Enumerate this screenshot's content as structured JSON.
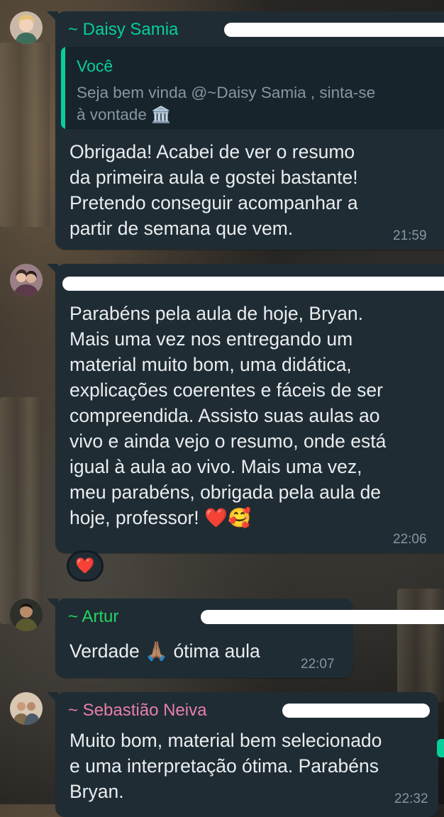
{
  "colors": {
    "bubble": "#1f2c33",
    "text": "#e9edef",
    "meta": "#8696a0",
    "quote_accent": "#06cf9c",
    "sender_daisy": "#06cf9c",
    "sender_artur": "#25d366",
    "sender_sebastiao": "#e87fa8"
  },
  "messages": [
    {
      "sender": "~ Daisy Samia",
      "avatar_icon": "woman-avatar-icon",
      "quote": {
        "author": "Você",
        "text": "Seja bem vinda @~Daisy Samia , sinta-se\nà vontade 🏛️"
      },
      "text": "Obrigada! Acabei de ver o resumo\nda primeira aula e gostei bastante!\nPretendo conseguir acompanhar a\npartir de semana que vem.",
      "time": "21:59"
    },
    {
      "sender": "",
      "avatar_icon": "couple-avatar-icon",
      "text": "Parabéns pela aula de hoje, Bryan.\nMais uma vez nos entregando um\nmaterial muito bom, uma didática,\nexplicações coerentes e fáceis de ser\ncompreendida. Assisto suas aulas ao\nvivo e ainda vejo o resumo, onde está\nigual à aula ao vivo. Mais uma vez,\nmeu parabéns, obrigada pela aula de\nhoje, professor! ❤️🥰",
      "time": "22:06",
      "reaction": "❤️"
    },
    {
      "sender": "~ Artur",
      "avatar_icon": "man-avatar-icon",
      "text": "Verdade 🙏🏽 ótima aula",
      "time": "22:07"
    },
    {
      "sender": "~ Sebastião Neiva",
      "avatar_icon": "group-avatar-icon",
      "text": "Muito bom, material bem selecionado\ne uma interpretação ótima. Parabéns\nBryan.",
      "time": "22:32"
    }
  ]
}
